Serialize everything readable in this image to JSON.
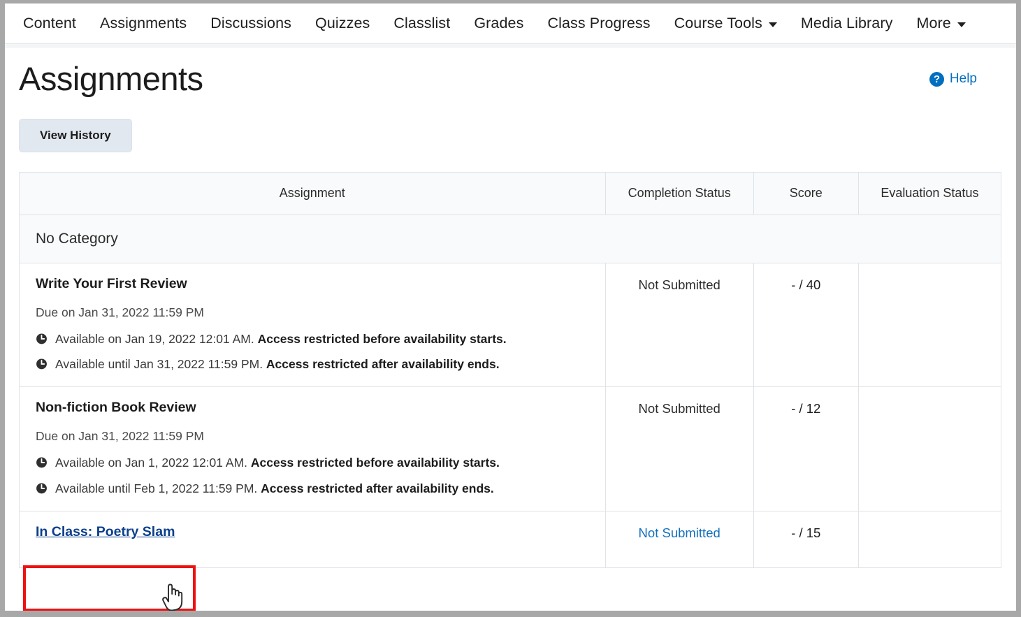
{
  "nav": {
    "items": [
      {
        "label": "Content",
        "has_caret": false
      },
      {
        "label": "Assignments",
        "has_caret": false
      },
      {
        "label": "Discussions",
        "has_caret": false
      },
      {
        "label": "Quizzes",
        "has_caret": false
      },
      {
        "label": "Classlist",
        "has_caret": false
      },
      {
        "label": "Grades",
        "has_caret": false
      },
      {
        "label": "Class Progress",
        "has_caret": false
      },
      {
        "label": "Course Tools",
        "has_caret": true
      },
      {
        "label": "Media Library",
        "has_caret": false
      },
      {
        "label": "More",
        "has_caret": true
      }
    ]
  },
  "header": {
    "title": "Assignments",
    "help_label": "Help",
    "help_icon": "question-mark"
  },
  "toolbar": {
    "view_history_label": "View History"
  },
  "table": {
    "columns": [
      "Assignment",
      "Completion Status",
      "Score",
      "Evaluation Status"
    ],
    "category_label": "No Category",
    "rows": [
      {
        "title": "Write Your First Review",
        "is_link": false,
        "due": "Due on Jan 31, 2022 11:59 PM",
        "availability": [
          {
            "text": "Available on Jan 19, 2022 12:01 AM. ",
            "note": "Access restricted before availability starts."
          },
          {
            "text": "Available until Jan 31, 2022 11:59 PM. ",
            "note": "Access restricted after availability ends."
          }
        ],
        "completion_status": "Not Submitted",
        "completion_is_link": false,
        "score": "- / 40",
        "evaluation_status": ""
      },
      {
        "title": "Non-fiction Book Review",
        "is_link": false,
        "due": "Due on Jan 31, 2022 11:59 PM",
        "availability": [
          {
            "text": "Available on Jan 1, 2022 12:01 AM. ",
            "note": "Access restricted before availability starts."
          },
          {
            "text": "Available until Feb 1, 2022 11:59 PM. ",
            "note": "Access restricted after availability ends."
          }
        ],
        "completion_status": "Not Submitted",
        "completion_is_link": false,
        "score": "- / 12",
        "evaluation_status": ""
      },
      {
        "title": "In Class: Poetry Slam",
        "is_link": true,
        "due": "",
        "availability": [],
        "completion_status": "Not Submitted",
        "completion_is_link": true,
        "score": "- / 15",
        "evaluation_status": ""
      }
    ]
  },
  "annotation": {
    "highlight_color": "#ee1111",
    "target": "In Class: Poetry Slam",
    "cursor": "pointing-hand"
  },
  "colors": {
    "link": "#0b3f8c",
    "status_link": "#1270bd",
    "help_blue": "#006fbf",
    "button_bg": "#e2e8f0",
    "header_bg": "#f9fafc",
    "border": "#dfe3e8"
  }
}
